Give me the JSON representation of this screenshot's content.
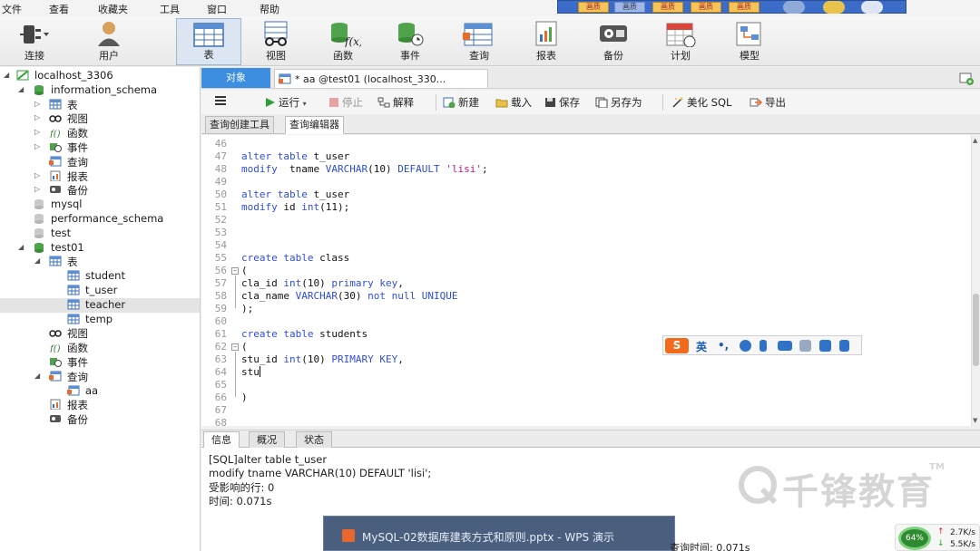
{
  "menubar": {
    "items": [
      "文件",
      "查看",
      "收藏夹",
      "工具",
      "窗口",
      "帮助"
    ]
  },
  "slide_strip": {
    "thumb_label": "画质"
  },
  "toolbar": {
    "items": [
      {
        "label": "连接",
        "icon": "plug-icon"
      },
      {
        "label": "用户",
        "icon": "user-icon"
      },
      {
        "label": "表",
        "icon": "table-icon"
      },
      {
        "label": "视图",
        "icon": "view-glasses-icon"
      },
      {
        "label": "函数",
        "icon": "function-icon"
      },
      {
        "label": "事件",
        "icon": "event-clock-icon"
      },
      {
        "label": "查询",
        "icon": "query-icon"
      },
      {
        "label": "报表",
        "icon": "report-icon"
      },
      {
        "label": "备份",
        "icon": "backup-icon"
      },
      {
        "label": "计划",
        "icon": "schedule-calendar-icon"
      },
      {
        "label": "模型",
        "icon": "model-icon"
      }
    ]
  },
  "tree": [
    {
      "label": "localhost_3306",
      "level": 0,
      "icon": "connection"
    },
    {
      "label": "information_schema",
      "level": 1,
      "icon": "database"
    },
    {
      "label": "表",
      "level": 2,
      "icon": "table"
    },
    {
      "label": "视图",
      "level": 2,
      "icon": "view"
    },
    {
      "label": "函数",
      "level": 2,
      "icon": "function"
    },
    {
      "label": "事件",
      "level": 2,
      "icon": "event"
    },
    {
      "label": "查询",
      "level": 2,
      "icon": "query"
    },
    {
      "label": "报表",
      "level": 2,
      "icon": "report"
    },
    {
      "label": "备份",
      "level": 2,
      "icon": "backup"
    },
    {
      "label": "mysql",
      "level": 1,
      "icon": "database-gray"
    },
    {
      "label": "performance_schema",
      "level": 1,
      "icon": "database-gray"
    },
    {
      "label": "test",
      "level": 1,
      "icon": "database-gray"
    },
    {
      "label": "test01",
      "level": 1,
      "icon": "database"
    },
    {
      "label": "表",
      "level": 2,
      "icon": "table"
    },
    {
      "label": "student",
      "level": 3,
      "icon": "table"
    },
    {
      "label": "t_user",
      "level": 3,
      "icon": "table"
    },
    {
      "label": "teacher",
      "level": 3,
      "icon": "table"
    },
    {
      "label": "temp",
      "level": 3,
      "icon": "table"
    },
    {
      "label": "视图",
      "level": 2,
      "icon": "view"
    },
    {
      "label": "函数",
      "level": 2,
      "icon": "function"
    },
    {
      "label": "事件",
      "level": 2,
      "icon": "event"
    },
    {
      "label": "查询",
      "level": 2,
      "icon": "query"
    },
    {
      "label": "aa",
      "level": 3,
      "icon": "query"
    },
    {
      "label": "报表",
      "level": 2,
      "icon": "report"
    },
    {
      "label": "备份",
      "level": 2,
      "icon": "backup"
    }
  ],
  "tabs": {
    "objects": "对象",
    "query_tab": "* aa @test01 (localhost_330..."
  },
  "editor_toolbar": {
    "run": "运行",
    "stop": "停止",
    "explain": "解释",
    "new": "新建",
    "load": "载入",
    "save": "保存",
    "save_as": "另存为",
    "beautify": "美化 SQL",
    "export": "导出"
  },
  "subtabs": {
    "builder": "查询创建工具",
    "editor": "查询编辑器"
  },
  "code": {
    "lines": [
      {
        "n": "46",
        "t": ""
      },
      {
        "n": "47",
        "t": "alter table t_user"
      },
      {
        "n": "48",
        "t": "modify  tname VARCHAR(10) DEFAULT 'lisi';"
      },
      {
        "n": "49",
        "t": ""
      },
      {
        "n": "50",
        "t": "alter table t_user"
      },
      {
        "n": "51",
        "t": "modify id int(11);"
      },
      {
        "n": "52",
        "t": ""
      },
      {
        "n": "53",
        "t": ""
      },
      {
        "n": "54",
        "t": ""
      },
      {
        "n": "55",
        "t": "create table class"
      },
      {
        "n": "56",
        "t": "("
      },
      {
        "n": "57",
        "t": "cla_id int(10) primary key,"
      },
      {
        "n": "58",
        "t": "cla_name VARCHAR(30) not null UNIQUE"
      },
      {
        "n": "59",
        "t": ");"
      },
      {
        "n": "60",
        "t": ""
      },
      {
        "n": "61",
        "t": "create table students"
      },
      {
        "n": "62",
        "t": "("
      },
      {
        "n": "63",
        "t": "stu_id int(10) PRIMARY KEY,"
      },
      {
        "n": "64",
        "t": "stu"
      },
      {
        "n": "65",
        "t": ""
      },
      {
        "n": "66",
        "t": ")"
      },
      {
        "n": "67",
        "t": ""
      },
      {
        "n": "68",
        "t": ""
      }
    ]
  },
  "ime": {
    "lang": "英",
    "punct": "•,"
  },
  "bottom_tabs": [
    "信息",
    "概况",
    "状态"
  ],
  "messages": [
    "[SQL]alter table t_user",
    "modify  tname VARCHAR(10) DEFAULT 'lisi';",
    "受影响的行: 0",
    "时间: 0.071s"
  ],
  "watermark": {
    "text": "千锋教育",
    "tm": "TM"
  },
  "taskbar": {
    "popup_label": "MySQL-02数据库建表方式和原则.pptx - WPS 演示"
  },
  "status": {
    "query_time": "查询时间: 0.071s"
  },
  "net": {
    "percent": "64%",
    "up": "2.7K/s",
    "down": "5.5K/s"
  },
  "colors": {
    "keyword": "#2e4de0",
    "string": "#b71c8a",
    "objects_tab": "#3d8de0"
  }
}
